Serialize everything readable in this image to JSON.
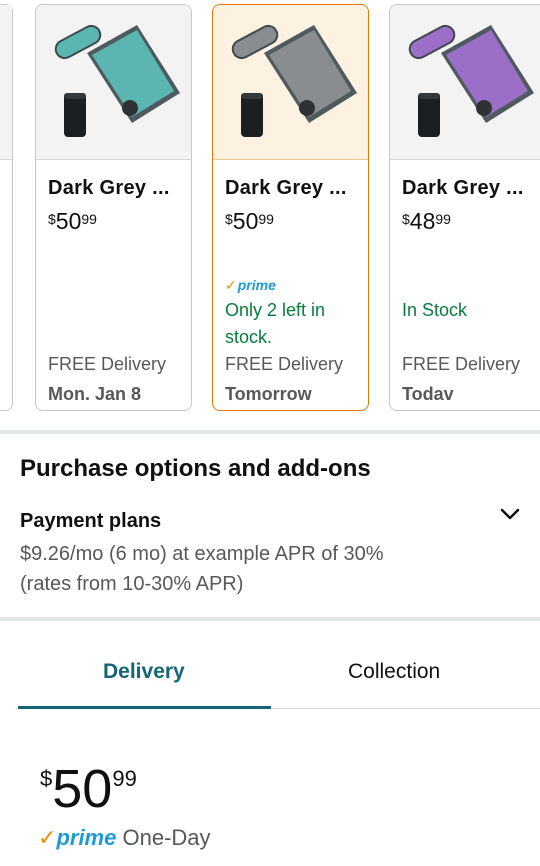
{
  "variants": [
    {
      "title": "Dark Grey ...",
      "price_symbol": "$",
      "price_whole": "50",
      "price_fraction": "99",
      "prime": "",
      "stock": "",
      "delivery_label": "FREE Delivery",
      "delivery_day": "Mon. Jan 8",
      "color": "teal",
      "selected": false
    },
    {
      "title": "Dark Grey ...",
      "price_symbol": "$",
      "price_whole": "50",
      "price_fraction": "99",
      "prime": "prime",
      "stock": "Only 2 left in stock.",
      "stock_line1": "Only 2 left in",
      "stock_line2": "stock.",
      "delivery_label": "FREE Delivery",
      "delivery_day": "Tomorrow",
      "color": "grey",
      "selected": true
    },
    {
      "title": "Dark Grey ...",
      "price_symbol": "$",
      "price_whole": "48",
      "price_fraction": "99",
      "prime": "",
      "stock": "In Stock",
      "delivery_label": "FREE Delivery",
      "delivery_day": "Todav",
      "color": "purple",
      "selected": false
    }
  ],
  "purchase_options": {
    "title": "Purchase options and add-ons",
    "payment_plans": {
      "title": "Payment plans",
      "line1": "$9.26/mo (6 mo) at example APR of 30%",
      "line2": "(rates from 10-30% APR)"
    }
  },
  "tabs": [
    {
      "label": "Delivery",
      "active": true
    },
    {
      "label": "Collection",
      "active": false
    }
  ],
  "delivery_panel": {
    "price_symbol": "$",
    "price_whole": "50",
    "price_fraction": "99",
    "prime_check": "✓",
    "prime_label": "prime",
    "speed": "One-Day"
  },
  "colors": {
    "accent_teal": "#146575",
    "selected_border": "#e77600",
    "stock_green": "#067d3e",
    "prime_blue": "#1f9bd6",
    "prime_check_orange": "#f08a00",
    "mat_teal": "#5bb5b0",
    "mat_grey": "#8a8d8f",
    "mat_purple": "#9b6ec8"
  },
  "icons": {
    "chevron": "chevron-down-icon",
    "product_image": "acupressure-mat-image"
  }
}
